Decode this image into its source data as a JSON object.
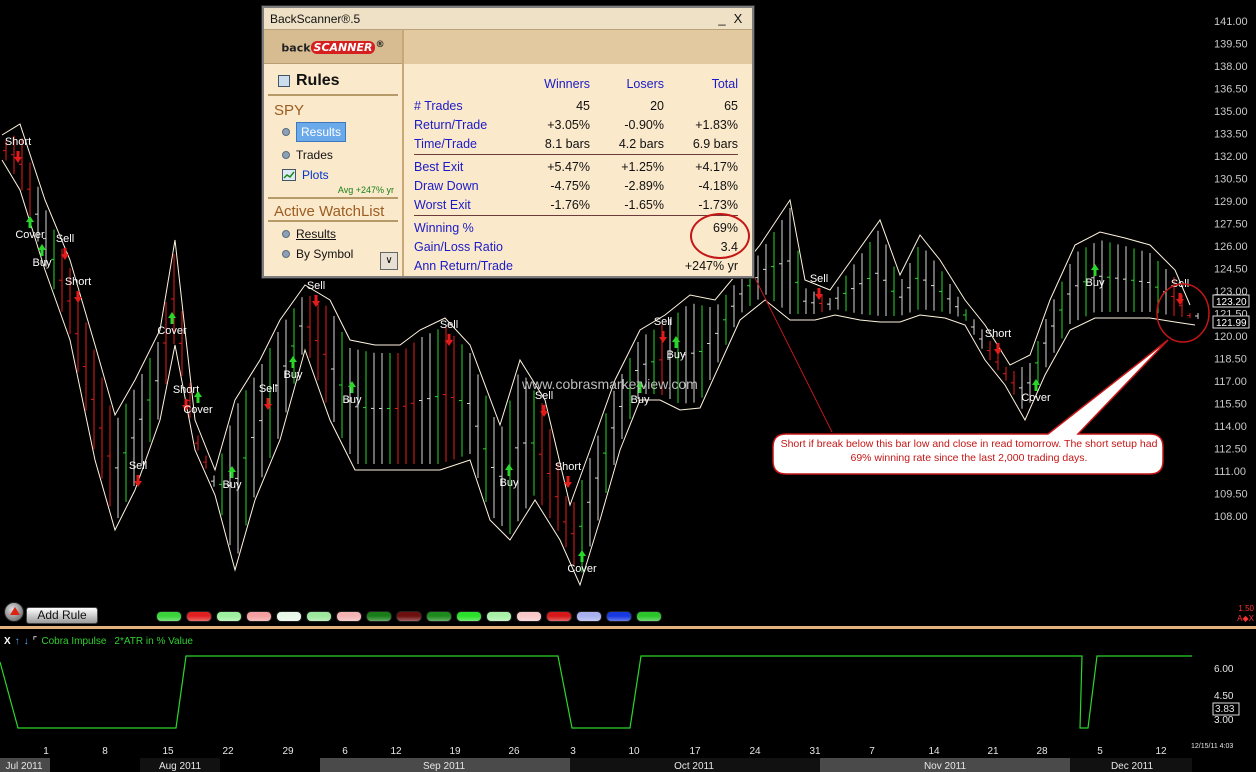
{
  "window": {
    "title": "BackScanner®.5",
    "minimize": "_",
    "close": "X",
    "logo_text": "back",
    "logo_brand": "SCANNER",
    "logo_mark": "®",
    "rules_heading": "Rules",
    "symbol": "SPY",
    "items": [
      {
        "label": "Results"
      },
      {
        "label": "Trades"
      },
      {
        "label": "Plots"
      }
    ],
    "avg": "Avg +247% yr",
    "watchlist_heading": "Active WatchList",
    "watchlist_items": [
      {
        "label": "Results"
      },
      {
        "label": "By Symbol"
      }
    ],
    "dropdown": "∨",
    "stats_header": {
      "winners": "Winners",
      "losers": "Losers",
      "total": "Total"
    },
    "stats": [
      {
        "label": "# Trades",
        "w": "45",
        "l": "20",
        "t": "65"
      },
      {
        "label": "Return/Trade",
        "w": "+3.05%",
        "l": "-0.90%",
        "t": "+1.83%"
      },
      {
        "label": "Time/Trade",
        "w": "8.1 bars",
        "l": "4.2 bars",
        "t": "6.9 bars"
      },
      {
        "label": "Best Exit",
        "w": "+5.47%",
        "l": "+1.25%",
        "t": "+4.17%"
      },
      {
        "label": "Draw Down",
        "w": "-4.75%",
        "l": "-2.89%",
        "t": "-4.18%"
      },
      {
        "label": "Worst Exit",
        "w": "-1.76%",
        "l": "-1.65%",
        "t": "-1.73%"
      },
      {
        "label": "Winning %",
        "w": "",
        "l": "",
        "t": "69%"
      },
      {
        "label": "Gain/Loss Ratio",
        "w": "",
        "l": "",
        "t": "3.4"
      },
      {
        "label": "Ann Return/Trade",
        "w": "",
        "l": "",
        "t": "+247% yr"
      }
    ]
  },
  "watermark": "www.cobrasmarketview.com",
  "callout": "Short if break below this bar low and close in read tomorrow. The short setup had 69% winning rate since the last 2,000 trading days.",
  "price_axis": [
    "141.00",
    "139.50",
    "138.00",
    "136.50",
    "135.00",
    "133.50",
    "132.00",
    "130.50",
    "129.00",
    "127.50",
    "126.00",
    "124.50",
    "123.00",
    "121.50",
    "120.00",
    "118.50",
    "117.00",
    "115.50",
    "114.00",
    "112.50",
    "111.00",
    "109.50",
    "108.00"
  ],
  "price_tags": {
    "upper": "123.20",
    "lower": "121.99"
  },
  "signals": [
    {
      "label": "Short",
      "type": "short"
    },
    {
      "label": "Cover",
      "type": "cover"
    },
    {
      "label": "Buy",
      "type": "buy"
    },
    {
      "label": "Sell",
      "type": "sell"
    },
    {
      "label": "Short",
      "type": "short"
    },
    {
      "label": "Cover",
      "type": "cover"
    },
    {
      "label": "Short",
      "type": "short"
    },
    {
      "label": "Cover",
      "type": "cover"
    },
    {
      "label": "Sell",
      "type": "sell"
    },
    {
      "label": "Buy",
      "type": "buy"
    },
    {
      "label": "Sell",
      "type": "sell"
    },
    {
      "label": "Buy",
      "type": "buy"
    },
    {
      "label": "Sell",
      "type": "sell"
    },
    {
      "label": "Buy",
      "type": "buy"
    },
    {
      "label": "Sell",
      "type": "sell"
    },
    {
      "label": "Buy",
      "type": "buy"
    },
    {
      "label": "Sell",
      "type": "sell"
    },
    {
      "label": "Short",
      "type": "short"
    },
    {
      "label": "Cover",
      "type": "cover"
    },
    {
      "label": "Buy",
      "type": "buy"
    },
    {
      "label": "Sell",
      "type": "sell"
    },
    {
      "label": "Buy",
      "type": "buy"
    },
    {
      "label": "Sell",
      "type": "sell"
    },
    {
      "label": "Short",
      "type": "short"
    },
    {
      "label": "Cover",
      "type": "cover"
    },
    {
      "label": "Buy",
      "type": "buy"
    },
    {
      "label": "Sell",
      "type": "sell"
    }
  ],
  "add_rule": "Add Rule",
  "pill_colors": [
    "#3ad43a",
    "#e02020",
    "#9df09d",
    "#f4a0a0",
    "#e8f8e8",
    "#9de69d",
    "#f4b4b4",
    "#187d18",
    "#6e1010",
    "#1d8a1d",
    "#2ae02a",
    "#a8f0a8",
    "#f8c8c8",
    "#d61818",
    "#a8b0f0",
    "#1838e0",
    "#2bc42b"
  ],
  "corner_labels": [
    "1.50",
    "A◆X"
  ],
  "indicator": {
    "close": "X",
    "up": "↑",
    "down": "↓",
    "title": "Cobra Impulse",
    "subtitle": "2*ATR in % Value",
    "axis": [
      "6.00",
      "4.50",
      "3.00"
    ],
    "value": "3.83"
  },
  "dates": [
    "1",
    "8",
    "15",
    "22",
    "29",
    "6",
    "12",
    "19",
    "26",
    "3",
    "10",
    "17",
    "24",
    "31",
    "7",
    "14",
    "21",
    "28",
    "5",
    "12"
  ],
  "timestamp": "12/15/11 4:03",
  "months": [
    "Jul 2011",
    "Aug 2011",
    "Sep 2011",
    "Oct 2011",
    "Nov 2011",
    "Dec 2011"
  ],
  "colors": {
    "price_line": "#fff5df",
    "up_bar": "#2bd62b",
    "down_bar": "#e21b1b",
    "indicator_line": "#2bd62b",
    "callout_border": "#c41616"
  }
}
